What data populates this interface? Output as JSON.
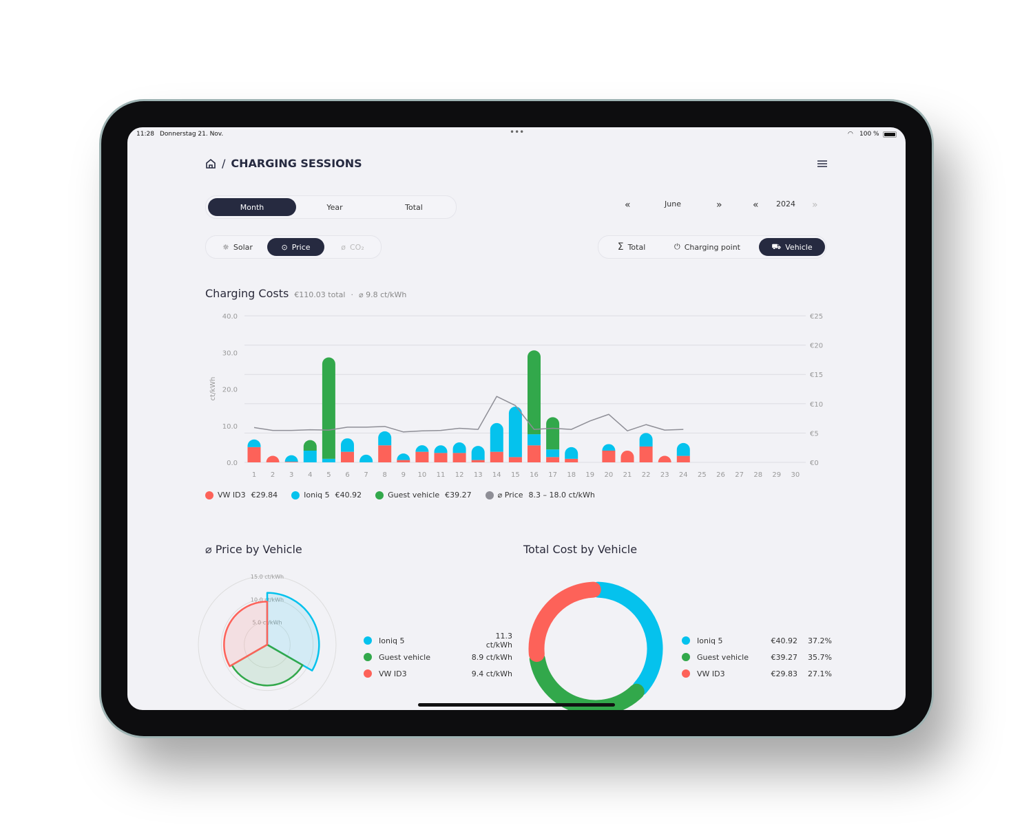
{
  "status": {
    "time": "11:28",
    "date": "Donnerstag 21. Nov.",
    "battery": "100 %"
  },
  "header": {
    "title": "CHARGING SESSIONS",
    "separator": "/"
  },
  "period_tabs": [
    {
      "label": "Month",
      "active": true
    },
    {
      "label": "Year",
      "active": false
    },
    {
      "label": "Total",
      "active": false
    }
  ],
  "period_nav": {
    "month": "June",
    "year": "2024"
  },
  "metric_tabs": [
    {
      "label": "Solar",
      "icon": "sun-icon",
      "active": false
    },
    {
      "label": "Price",
      "icon": "coins-icon",
      "active": true
    },
    {
      "label": "CO₂",
      "icon": "leaf-icon",
      "active": false,
      "disabled": true
    }
  ],
  "group_tabs": [
    {
      "label": "Total",
      "icon": "sigma-icon",
      "active": false
    },
    {
      "label": "Charging point",
      "icon": "plug-icon",
      "active": false
    },
    {
      "label": "Vehicle",
      "icon": "car-icon",
      "active": true
    }
  ],
  "costs": {
    "title": "Charging Costs",
    "total": "€110.03 total",
    "avg": "⌀ 9.8 ct/kWh",
    "separator": "·"
  },
  "colors": {
    "vw": "#fd6259",
    "ioniq": "#05c2ed",
    "guest": "#32a84b",
    "price": "#8e8e96",
    "dark": "#262a40"
  },
  "chart_data": {
    "type": "bar",
    "stacked": true,
    "x": [
      1,
      2,
      3,
      4,
      5,
      6,
      7,
      8,
      9,
      10,
      11,
      12,
      13,
      14,
      15,
      16,
      17,
      18,
      19,
      20,
      21,
      22,
      23,
      24,
      25,
      26,
      27,
      28,
      29,
      30
    ],
    "ylabel": "ct/kWh",
    "y_left_ticks": [
      "0.0",
      "10.0",
      "20.0",
      "30.0",
      "40.0"
    ],
    "ylim_left": [
      0,
      40
    ],
    "y_right_ticks": [
      "€0",
      "€5",
      "€10",
      "€15",
      "€20",
      "€25"
    ],
    "ylim_right": [
      0,
      25
    ],
    "grid": true,
    "series": [
      {
        "name": "VW ID3",
        "key": "vw",
        "axis": "right",
        "values": [
          2.6,
          0.6,
          0.1,
          0,
          0,
          1.8,
          0,
          2.9,
          0.4,
          1.8,
          1.6,
          1.6,
          0.4,
          1.8,
          0.9,
          2.9,
          0.9,
          0.6,
          0,
          2.0,
          2.0,
          2.7,
          0.4,
          1.1,
          0,
          0,
          0,
          0,
          0,
          0
        ]
      },
      {
        "name": "Ioniq 5",
        "key": "ioniq",
        "axis": "right",
        "values": [
          1.3,
          0,
          0.3,
          2.0,
          0.6,
          2.3,
          1.3,
          2.4,
          0.5,
          0.9,
          1.3,
          1.8,
          2.4,
          4.9,
          8.6,
          1.9,
          1.3,
          2.0,
          0,
          0.9,
          0,
          2.3,
          0,
          2.2,
          0,
          0,
          0,
          0,
          0,
          0
        ]
      },
      {
        "name": "Guest vehicle",
        "key": "guest",
        "axis": "right",
        "values": [
          0,
          0,
          0,
          1.8,
          17.3,
          0,
          0,
          0,
          0,
          0,
          0,
          0,
          0,
          0,
          0,
          14.3,
          5.5,
          0,
          0,
          0,
          0,
          0,
          0,
          0,
          0,
          0,
          0,
          0,
          0,
          0
        ]
      },
      {
        "name": "⌀ Price",
        "key": "price",
        "type": "line",
        "axis": "left",
        "values": [
          9.5,
          8.7,
          8.7,
          8.9,
          8.8,
          9.6,
          9.6,
          9.8,
          8.3,
          8.6,
          8.7,
          9.3,
          9.0,
          18.0,
          15.5,
          9.0,
          9.3,
          9.0,
          11.3,
          13.1,
          8.6,
          10.3,
          8.8,
          9.0,
          null,
          null,
          null,
          null,
          null,
          null
        ]
      }
    ],
    "legend": [
      {
        "key": "vw",
        "name": "VW ID3",
        "value": "€29.84"
      },
      {
        "key": "ioniq",
        "name": "Ioniq 5",
        "value": "€40.92"
      },
      {
        "key": "guest",
        "name": "Guest vehicle",
        "value": "€39.27"
      },
      {
        "key": "price",
        "name": "⌀ Price",
        "value": "8.3 – 18.0 ct/kWh"
      }
    ]
  },
  "price_by_vehicle": {
    "title": "⌀ Price by Vehicle",
    "type": "polar",
    "rings": [
      "5.0 ct/kWh",
      "10.0 ct/kWh",
      "15.0 ct/kWh"
    ],
    "max": 15,
    "items": [
      {
        "key": "ioniq",
        "name": "Ioniq 5",
        "value": 11.3,
        "label": "11.3 ct/kWh"
      },
      {
        "key": "guest",
        "name": "Guest vehicle",
        "value": 8.9,
        "label": "8.9 ct/kWh"
      },
      {
        "key": "vw",
        "name": "VW ID3",
        "value": 9.4,
        "label": "9.4 ct/kWh"
      }
    ]
  },
  "cost_by_vehicle": {
    "title": "Total Cost by Vehicle",
    "type": "pie",
    "items": [
      {
        "key": "ioniq",
        "name": "Ioniq 5",
        "value": "€40.92",
        "percent": 37.2,
        "percent_label": "37.2%"
      },
      {
        "key": "guest",
        "name": "Guest vehicle",
        "value": "€39.27",
        "percent": 35.7,
        "percent_label": "35.7%"
      },
      {
        "key": "vw",
        "name": "VW ID3",
        "value": "€29.83",
        "percent": 27.1,
        "percent_label": "27.1%"
      }
    ]
  }
}
